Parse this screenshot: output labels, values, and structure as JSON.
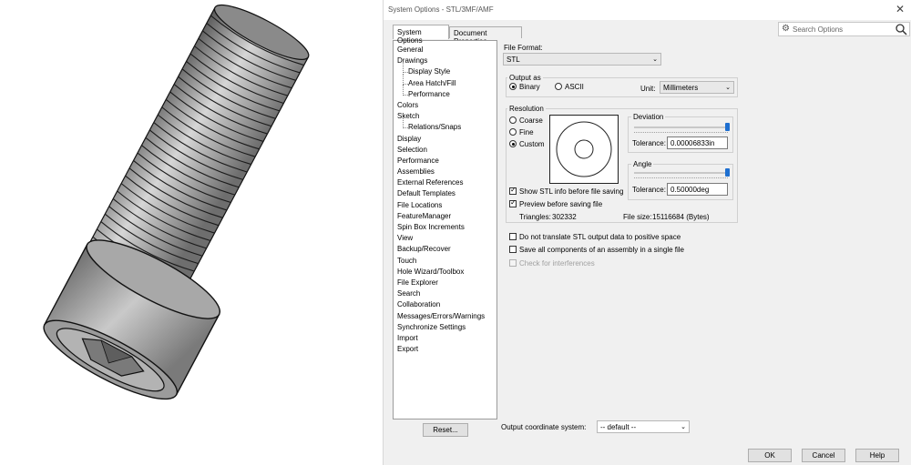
{
  "window": {
    "title": "System Options - STL/3MF/AMF",
    "close_glyph": "✕"
  },
  "tabs": [
    {
      "label": "System Options",
      "active": true
    },
    {
      "label": "Document Properties",
      "active": false
    }
  ],
  "search": {
    "placeholder": "Search Options",
    "icon": "gear-icon"
  },
  "tree": {
    "items": [
      {
        "label": "General"
      },
      {
        "label": "Drawings"
      },
      {
        "label": "Display Style",
        "child": true
      },
      {
        "label": "Area Hatch/Fill",
        "child": true
      },
      {
        "label": "Performance",
        "child": true
      },
      {
        "label": "Colors"
      },
      {
        "label": "Sketch"
      },
      {
        "label": "Relations/Snaps",
        "child": true
      },
      {
        "label": "Display"
      },
      {
        "label": "Selection"
      },
      {
        "label": "Performance"
      },
      {
        "label": "Assemblies"
      },
      {
        "label": "External References"
      },
      {
        "label": "Default Templates"
      },
      {
        "label": "File Locations"
      },
      {
        "label": "FeatureManager"
      },
      {
        "label": "Spin Box Increments"
      },
      {
        "label": "View"
      },
      {
        "label": "Backup/Recover"
      },
      {
        "label": "Touch"
      },
      {
        "label": "Hole Wizard/Toolbox"
      },
      {
        "label": "File Explorer"
      },
      {
        "label": "Search"
      },
      {
        "label": "Collaboration"
      },
      {
        "label": "Messages/Errors/Warnings"
      },
      {
        "label": "Synchronize Settings"
      },
      {
        "label": "Import"
      },
      {
        "label": "Export"
      }
    ],
    "reset_label": "Reset..."
  },
  "file_format": {
    "label": "File Format:",
    "value": "STL"
  },
  "output_as": {
    "label": "Output as",
    "binary_label": "Binary",
    "ascii_label": "ASCII",
    "selected": "Binary",
    "unit_label": "Unit:",
    "unit_value": "Millimeters"
  },
  "resolution": {
    "label": "Resolution",
    "coarse_label": "Coarse",
    "fine_label": "Fine",
    "custom_label": "Custom",
    "selected": "Custom",
    "deviation_label": "Deviation",
    "deviation_tolerance_label": "Tolerance:",
    "deviation_tolerance_value": "0.00006833in",
    "deviation_slider_fraction": 1.0,
    "angle_label": "Angle",
    "angle_tolerance_label": "Tolerance:",
    "angle_tolerance_value": "0.50000deg",
    "angle_slider_fraction": 1.0,
    "show_info_label": "Show STL info before file saving",
    "show_info_checked": true,
    "preview_label": "Preview before saving file",
    "preview_checked": true,
    "triangles_label": "Triangles:",
    "triangles_value": "302332",
    "file_size_label": "File size:",
    "file_size_value": "15116684 (Bytes)"
  },
  "options": {
    "no_translate_label": "Do not translate STL output data to positive space",
    "no_translate_checked": false,
    "save_all_label": "Save all components of an assembly in a single file",
    "save_all_checked": false,
    "check_interferences_label": "Check for interferences",
    "check_interferences_checked": false,
    "check_interferences_disabled": true
  },
  "output_coordinate": {
    "label": "Output coordinate system:",
    "value": "-- default --"
  },
  "footer": {
    "ok_label": "OK",
    "cancel_label": "Cancel",
    "help_label": "Help"
  },
  "colors": {
    "accent": "#1e6fd0",
    "dialog_bg": "#f0f0f0",
    "model_gray": "#9a9a9a"
  }
}
